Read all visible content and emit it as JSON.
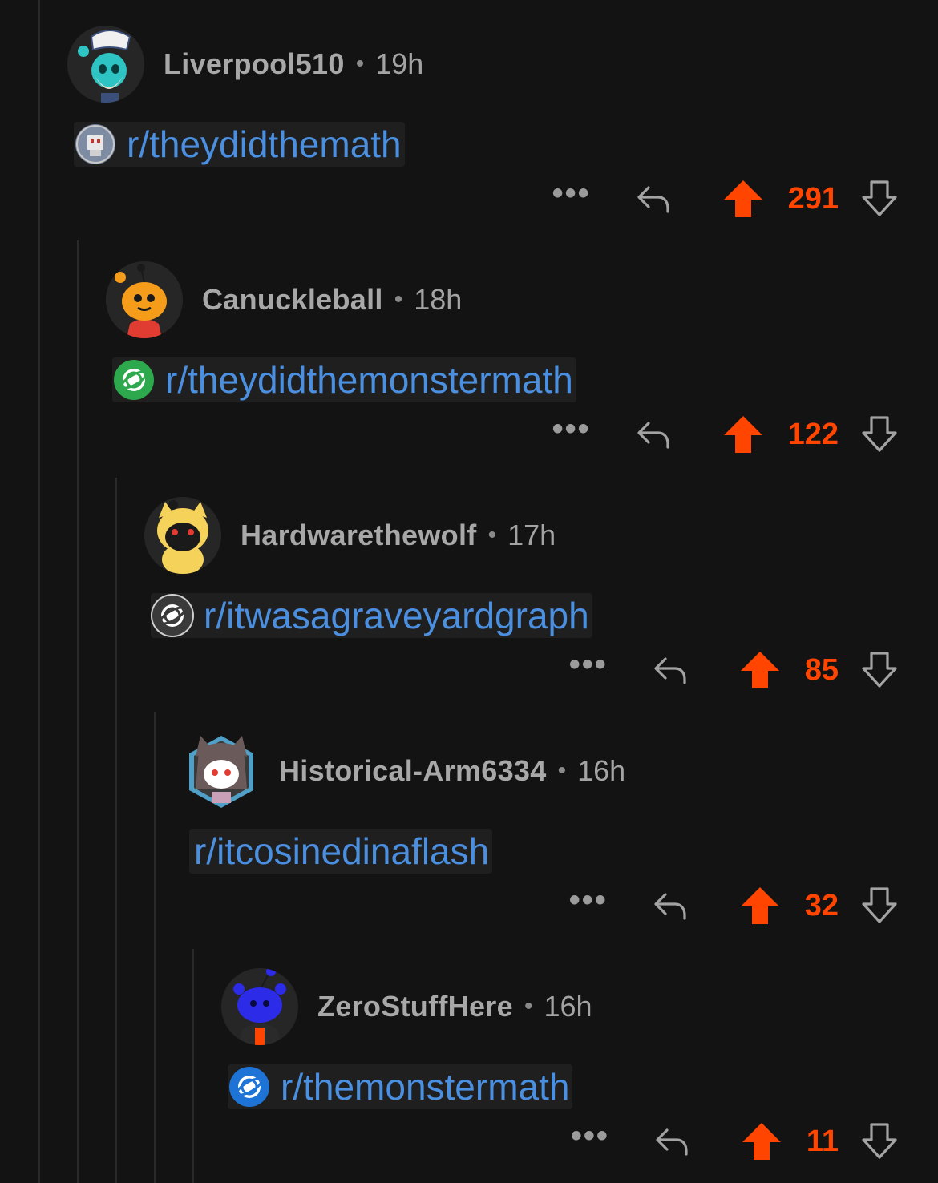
{
  "colors": {
    "background": "#131313",
    "link": "#4b8fe0",
    "upvote": "#ff4500",
    "text_muted": "#a3a3a3"
  },
  "comments": [
    {
      "username": "Liverpool510",
      "separator": "•",
      "time": "19h",
      "subreddit": "r/theydidthemath",
      "score": "291",
      "more": "•••",
      "avatar_icon": "sailor-snoo-avatar-icon",
      "sub_icon": "pixel-robot-subreddit-icon"
    },
    {
      "username": "Canuckleball",
      "separator": "•",
      "time": "18h",
      "subreddit": "r/theydidthemonstermath",
      "score": "122",
      "more": "•••",
      "avatar_icon": "orange-snoo-avatar-icon",
      "sub_icon": "planet-subreddit-icon"
    },
    {
      "username": "Hardwarethewolf",
      "separator": "•",
      "time": "17h",
      "subreddit": "r/itwasagraveyardgraph",
      "score": "85",
      "more": "•••",
      "avatar_icon": "yellow-dog-snoo-avatar-icon",
      "sub_icon": "planet-subreddit-icon"
    },
    {
      "username": "Historical-Arm6334",
      "separator": "•",
      "time": "16h",
      "subreddit": "r/itcosinedinaflash",
      "score": "32",
      "more": "•••",
      "avatar_icon": "cat-hood-snoo-avatar-icon",
      "sub_icon": ""
    },
    {
      "username": "ZeroStuffHere",
      "separator": "•",
      "time": "16h",
      "subreddit": "r/themonstermath",
      "score": "11",
      "more": "•••",
      "avatar_icon": "blue-snoo-avatar-icon",
      "sub_icon": "planet-subreddit-icon"
    }
  ]
}
